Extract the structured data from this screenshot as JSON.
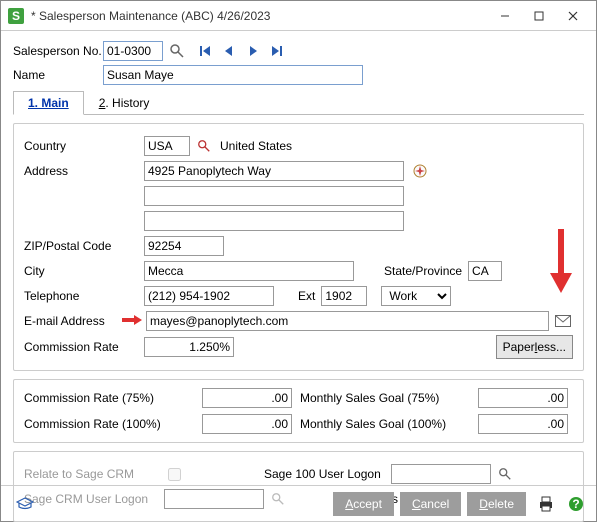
{
  "window": {
    "title": "* Salesperson Maintenance (ABC) 4/26/2023"
  },
  "header": {
    "salesperson_no_label": "Salesperson No.",
    "salesperson_no": "01-0300",
    "name_label": "Name",
    "name": "Susan Maye"
  },
  "tabs": {
    "main": "1. Main",
    "history": "2. History"
  },
  "main": {
    "country_label": "Country",
    "country_code": "USA",
    "country_name": "United States",
    "address_label": "Address",
    "address1": "4925 Panoplytech Way",
    "address2": "",
    "address3": "",
    "zip_label": "ZIP/Postal Code",
    "zip": "92254",
    "city_label": "City",
    "city": "Mecca",
    "state_label": "State/Province",
    "state": "CA",
    "telephone_label": "Telephone",
    "telephone": "(212) 954-1902",
    "ext_label": "Ext",
    "ext": "1902",
    "phone_type_options": [
      "Work"
    ],
    "phone_type": "Work",
    "email_label": "E-mail Address",
    "email": "mayes@panoplytech.com",
    "commission_label": "Commission Rate",
    "commission": "1.250%",
    "paperless_label": "Paperless..."
  },
  "goals": {
    "cr75_label": "Commission Rate (75%)",
    "cr75": ".00",
    "msg75_label": "Monthly Sales Goal (75%)",
    "msg75": ".00",
    "cr100_label": "Commission Rate (100%)",
    "cr100": ".00",
    "msg100_label": "Monthly Sales Goal (100%)",
    "msg100": ".00"
  },
  "crm": {
    "relate_label": "Relate to Sage CRM",
    "sage100_logon_label": "Sage 100 User Logon",
    "sagecrm_logon_label": "Sage CRM User Logon",
    "sales_manager_label": "Sales Manager"
  },
  "footer": {
    "accept": "Accept",
    "cancel": "Cancel",
    "delete": "Delete"
  }
}
